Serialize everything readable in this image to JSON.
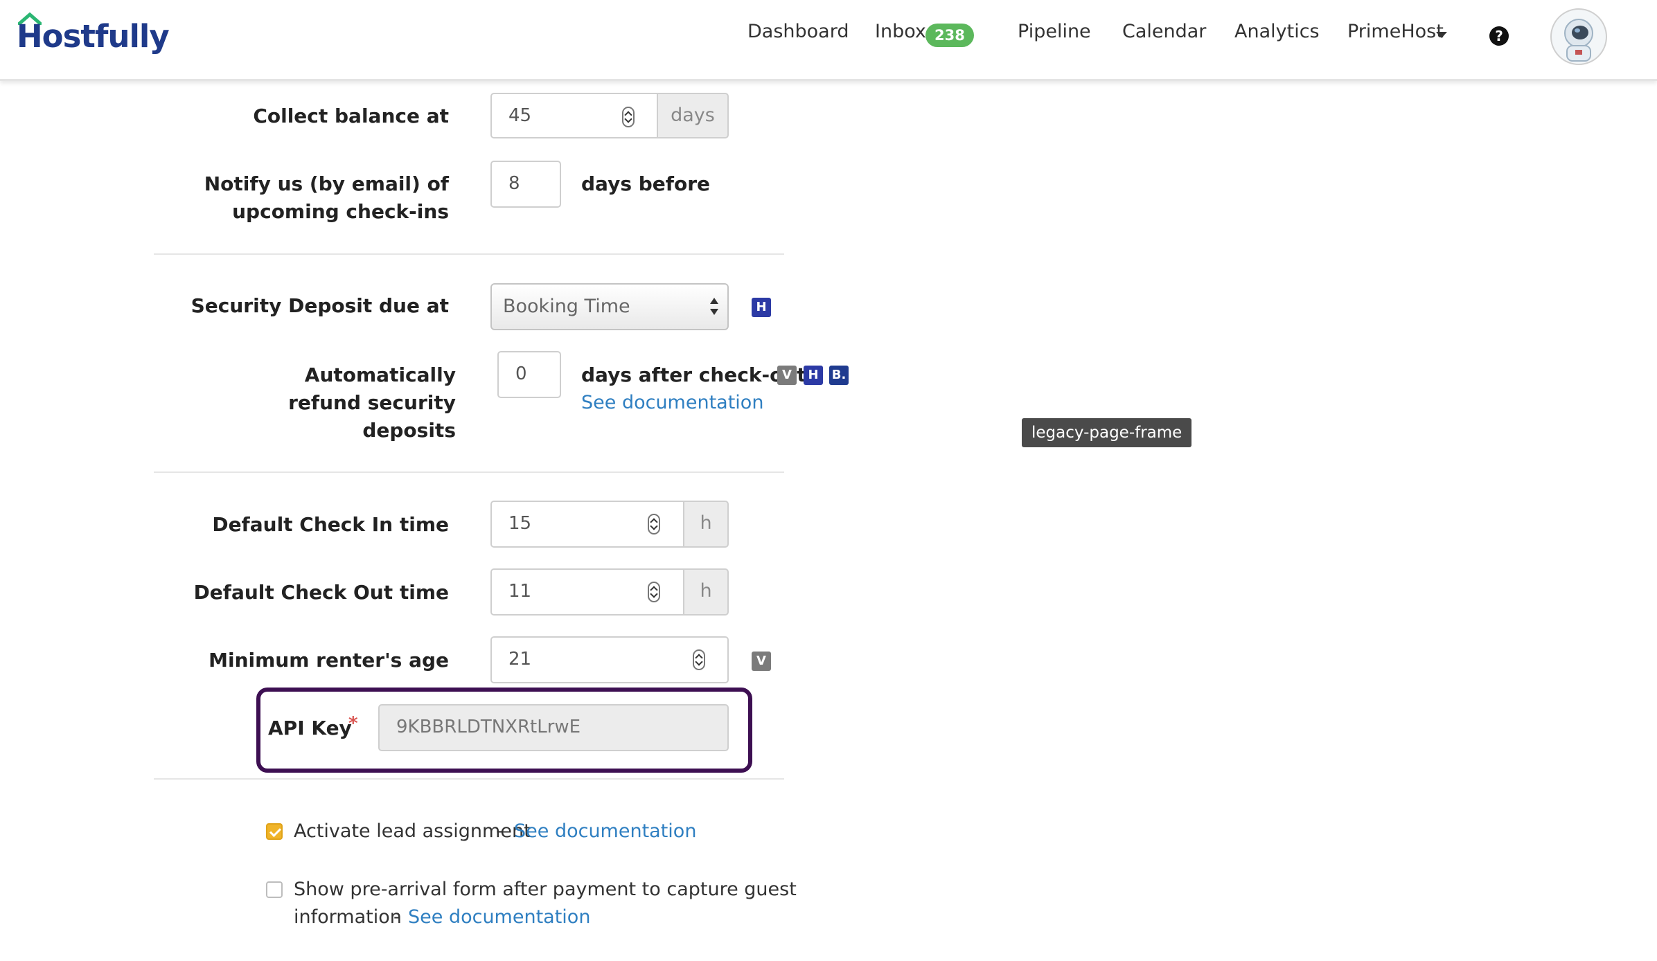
{
  "brand": {
    "logo_text": "Hostfully"
  },
  "nav": {
    "dashboard": "Dashboard",
    "inbox": "Inbox",
    "inbox_count": "238",
    "pipeline": "Pipeline",
    "calendar": "Calendar",
    "analytics": "Analytics",
    "account": "PrimeHost",
    "help_icon": "question-circle-icon",
    "avatar": "astronaut-avatar"
  },
  "form": {
    "collect_balance": {
      "label": "Collect balance at",
      "value": "45",
      "unit": "days"
    },
    "notify_checkins": {
      "label_line1": "Notify us (by email) of",
      "label_line2": "upcoming check-ins",
      "value": "8",
      "suffix": "days before"
    },
    "security_deposit": {
      "label": "Security Deposit due at",
      "selected": "Booking Time",
      "channel_icons": [
        "H"
      ]
    },
    "auto_refund": {
      "label_line1": "Automatically",
      "label_line2": "refund security",
      "label_line3": "deposits",
      "value": "0",
      "suffix": "days after check-out",
      "channel_icons": [
        "V",
        "H",
        "B."
      ],
      "doc_link": "See documentation"
    },
    "check_in_time": {
      "label": "Default Check In time",
      "value": "15",
      "unit": "h"
    },
    "check_out_time": {
      "label": "Default Check Out time",
      "value": "11",
      "unit": "h"
    },
    "min_age": {
      "label": "Minimum renter's age",
      "value": "21",
      "channel_icons": [
        "V"
      ]
    },
    "api_key": {
      "label": "API Key",
      "required_mark": "*",
      "value": "9KBBRLDTNXRtLrwE"
    },
    "lead_assignment": {
      "label": "Activate lead assignment",
      "separator": "-",
      "doc_link": "See documentation",
      "checked": true
    },
    "pre_arrival": {
      "label_line1": "Show pre-arrival form after payment to capture guest",
      "label_line2": "information",
      "separator": "-",
      "doc_link": "See documentation",
      "checked": false
    }
  },
  "tooltip": {
    "text": "legacy-page-frame"
  },
  "colors": {
    "brand": "#1f3a8a",
    "badge": "#5cb85c",
    "link": "#2f7fc1",
    "highlight": "#3d0f52",
    "checkbox_on": "#f0b429"
  }
}
